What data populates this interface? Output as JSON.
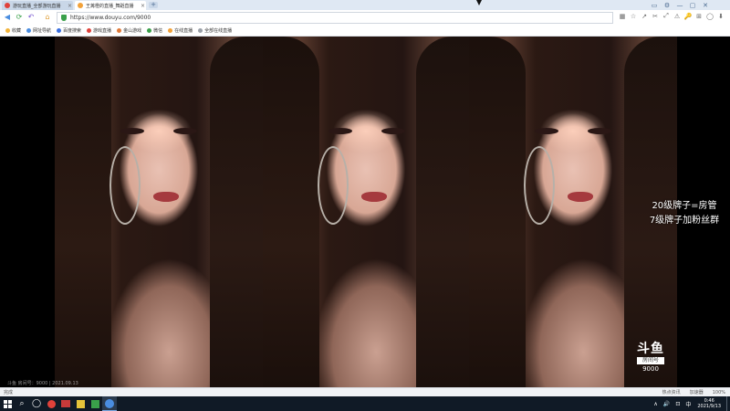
{
  "browser": {
    "tabs": [
      {
        "title": "游玩直播_全部游玩直播",
        "favicon_color": "#e0413a",
        "active": false
      },
      {
        "title": "王苒橙的直播_舞蹈直播",
        "favicon_color": "#f2a23a",
        "active": true
      }
    ],
    "new_tab": "+",
    "window_controls": [
      "▭",
      "⚙",
      "—",
      "▢",
      "✕"
    ],
    "url": "https://www.douyu.com/9000",
    "toolbar_right": [
      "▦",
      "☆",
      "↗",
      "✂",
      "⤢",
      "⚠",
      "🔑",
      "⊞",
      "◯",
      "⬇"
    ]
  },
  "bookmarks": [
    {
      "label": "收藏",
      "color": "#f2b43a"
    },
    {
      "label": "网址导航",
      "color": "#4a8de0"
    },
    {
      "label": "百度搜索",
      "color": "#3a6fe0"
    },
    {
      "label": "游戏直播",
      "color": "#e0413a"
    },
    {
      "label": "金山游戏",
      "color": "#e07a3a"
    },
    {
      "label": "微信",
      "color": "#3aa04a"
    },
    {
      "label": "在线直播",
      "color": "#f2a23a"
    },
    {
      "label": "全部在线直播",
      "color": "#9aa0a8"
    }
  ],
  "video": {
    "overlay_lines": [
      "20级牌子=房管",
      "7级牌子加粉丝群"
    ],
    "logo_main": "斗鱼",
    "logo_sub": "房间号",
    "logo_num": "9000",
    "watermark": "斗鱼 房间号：9000 | 2021.09.13"
  },
  "statusbar": {
    "left": "完成",
    "right": [
      "热点资讯",
      "加速器",
      "100%"
    ]
  },
  "taskbar": {
    "tray_icons": [
      "∧",
      "🔊",
      "⊡",
      "中"
    ],
    "time": "0:46",
    "date": "2021/9/13"
  }
}
